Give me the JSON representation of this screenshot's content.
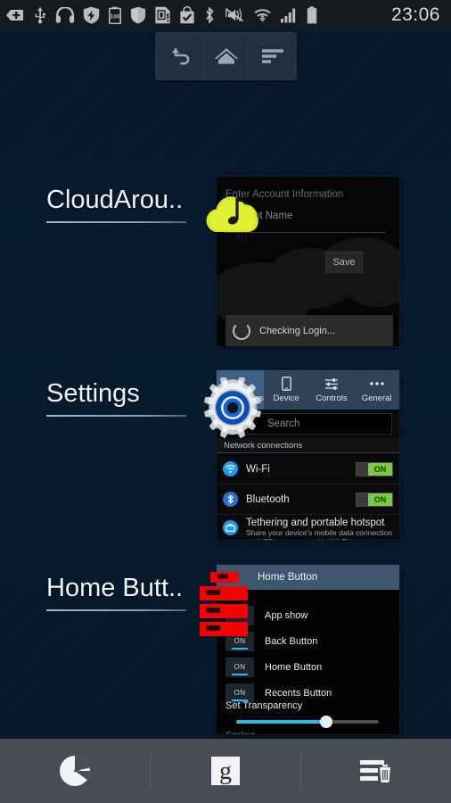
{
  "status_bar": {
    "time": "23:06",
    "icons": [
      {
        "name": "usb-tether-icon",
        "label": "USB tethering"
      },
      {
        "name": "usb-icon",
        "label": "USB connected"
      },
      {
        "name": "headset-icon",
        "label": "Headset connected"
      },
      {
        "name": "shield-bolt-icon",
        "label": "Power saving shield"
      },
      {
        "name": "battery-100-icon",
        "label": "100"
      },
      {
        "name": "shield-icon",
        "label": "Security"
      },
      {
        "name": "sd-card-icon",
        "label": "SD card"
      },
      {
        "name": "download-complete-icon",
        "label": "Download complete"
      },
      {
        "name": "bluetooth-icon",
        "label": "Bluetooth on"
      },
      {
        "name": "mute-vibrate-icon",
        "label": "Sound muted"
      },
      {
        "name": "wifi-icon",
        "label": "Wi-Fi connected"
      },
      {
        "name": "signal-icon",
        "label": "Mobile signal"
      },
      {
        "name": "battery-icon",
        "label": "Battery"
      }
    ],
    "battery_text": "100"
  },
  "floating_nav": {
    "buttons": [
      {
        "name": "back-button",
        "label": "Back"
      },
      {
        "name": "home-button",
        "label": "Home"
      },
      {
        "name": "recents-button",
        "label": "Recents"
      }
    ]
  },
  "recents": {
    "cards": [
      {
        "title": "CloudArou..",
        "app_icon": "cloud-music-icon",
        "preview": {
          "heading": "Enter Account Information",
          "field_label": "Account Name",
          "field_value": "",
          "save_label": "Save",
          "toast_text": "Checking Login..."
        }
      },
      {
        "title": "Settings",
        "app_icon": "gear-icon",
        "preview": {
          "tabs": [
            {
              "label": "Connections",
              "icon": "connections-icon",
              "active": true
            },
            {
              "label": "Device",
              "icon": "device-icon",
              "active": false
            },
            {
              "label": "Controls",
              "icon": "sliders-icon",
              "active": false
            },
            {
              "label": "General",
              "icon": "more-dots-icon",
              "active": false
            }
          ],
          "search_placeholder": "Search",
          "section_header": "Network connections",
          "rows": [
            {
              "label": "Wi-Fi",
              "icon": "wifi-icon",
              "toggle": "ON"
            },
            {
              "label": "Bluetooth",
              "icon": "bluetooth-icon",
              "toggle": "ON"
            }
          ],
          "tethering_title": "Tethering and portable hotspot",
          "tethering_sub": "Share your device's mobile data connection via USB or as a portable Wi-Fi hotspot"
        }
      },
      {
        "title": "Home Butt..",
        "app_icon": "red-bars-icon",
        "preview": {
          "app_title": "Home Button",
          "switches": [
            {
              "label": "App show",
              "state": "ON"
            },
            {
              "label": "Back Button",
              "state": "ON"
            },
            {
              "label": "Home Button",
              "state": "ON"
            },
            {
              "label": "Recents Button",
              "state": "ON"
            }
          ],
          "transparency_label": "Set Transparency",
          "transparency_percent": 63
        }
      }
    ]
  },
  "bottom_bar": {
    "items": [
      {
        "name": "task-manager-icon",
        "label": "Task manager"
      },
      {
        "name": "google-search-icon",
        "label": "g"
      },
      {
        "name": "clear-all-icon",
        "label": "Clear all"
      }
    ],
    "google_glyph": "g"
  },
  "colors": {
    "background": "#061a2e",
    "status_bar": "#161a1e",
    "bottom_bar": "#474d52",
    "accent_blue": "#33b5e5",
    "toggle_green": "#7ac943",
    "settings_tab": "#2e4258"
  }
}
